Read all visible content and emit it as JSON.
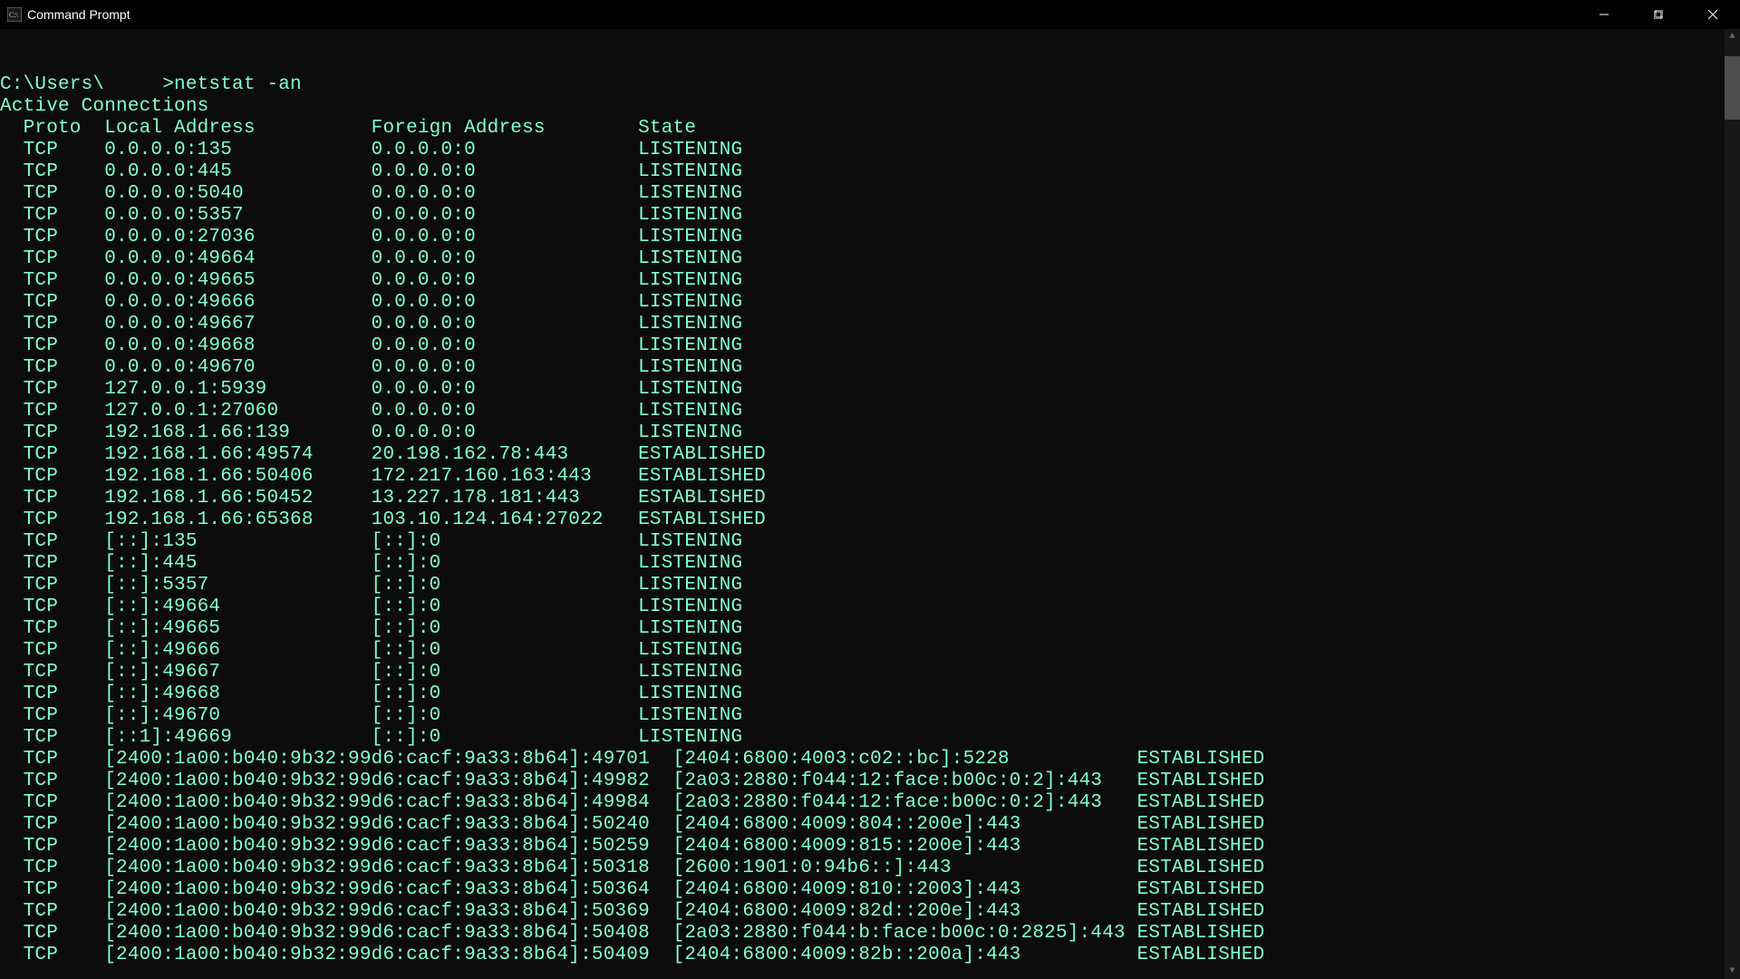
{
  "window": {
    "title": "Command Prompt"
  },
  "prompt": {
    "path": "C:\\Users\\",
    "command": ">netstat -an"
  },
  "section_header": "Active Connections",
  "columns": {
    "proto": "Proto",
    "local": "Local Address",
    "foreign": "Foreign Address",
    "state": "State"
  },
  "rows": [
    {
      "proto": "TCP",
      "local": "0.0.0.0:135",
      "foreign": "0.0.0.0:0",
      "state": "LISTENING"
    },
    {
      "proto": "TCP",
      "local": "0.0.0.0:445",
      "foreign": "0.0.0.0:0",
      "state": "LISTENING"
    },
    {
      "proto": "TCP",
      "local": "0.0.0.0:5040",
      "foreign": "0.0.0.0:0",
      "state": "LISTENING"
    },
    {
      "proto": "TCP",
      "local": "0.0.0.0:5357",
      "foreign": "0.0.0.0:0",
      "state": "LISTENING"
    },
    {
      "proto": "TCP",
      "local": "0.0.0.0:27036",
      "foreign": "0.0.0.0:0",
      "state": "LISTENING"
    },
    {
      "proto": "TCP",
      "local": "0.0.0.0:49664",
      "foreign": "0.0.0.0:0",
      "state": "LISTENING"
    },
    {
      "proto": "TCP",
      "local": "0.0.0.0:49665",
      "foreign": "0.0.0.0:0",
      "state": "LISTENING"
    },
    {
      "proto": "TCP",
      "local": "0.0.0.0:49666",
      "foreign": "0.0.0.0:0",
      "state": "LISTENING"
    },
    {
      "proto": "TCP",
      "local": "0.0.0.0:49667",
      "foreign": "0.0.0.0:0",
      "state": "LISTENING"
    },
    {
      "proto": "TCP",
      "local": "0.0.0.0:49668",
      "foreign": "0.0.0.0:0",
      "state": "LISTENING"
    },
    {
      "proto": "TCP",
      "local": "0.0.0.0:49670",
      "foreign": "0.0.0.0:0",
      "state": "LISTENING"
    },
    {
      "proto": "TCP",
      "local": "127.0.0.1:5939",
      "foreign": "0.0.0.0:0",
      "state": "LISTENING"
    },
    {
      "proto": "TCP",
      "local": "127.0.0.1:27060",
      "foreign": "0.0.0.0:0",
      "state": "LISTENING"
    },
    {
      "proto": "TCP",
      "local": "192.168.1.66:139",
      "foreign": "0.0.0.0:0",
      "state": "LISTENING"
    },
    {
      "proto": "TCP",
      "local": "192.168.1.66:49574",
      "foreign": "20.198.162.78:443",
      "state": "ESTABLISHED"
    },
    {
      "proto": "TCP",
      "local": "192.168.1.66:50406",
      "foreign": "172.217.160.163:443",
      "state": "ESTABLISHED"
    },
    {
      "proto": "TCP",
      "local": "192.168.1.66:50452",
      "foreign": "13.227.178.181:443",
      "state": "ESTABLISHED"
    },
    {
      "proto": "TCP",
      "local": "192.168.1.66:65368",
      "foreign": "103.10.124.164:27022",
      "state": "ESTABLISHED"
    },
    {
      "proto": "TCP",
      "local": "[::]:135",
      "foreign": "[::]:0",
      "state": "LISTENING"
    },
    {
      "proto": "TCP",
      "local": "[::]:445",
      "foreign": "[::]:0",
      "state": "LISTENING"
    },
    {
      "proto": "TCP",
      "local": "[::]:5357",
      "foreign": "[::]:0",
      "state": "LISTENING"
    },
    {
      "proto": "TCP",
      "local": "[::]:49664",
      "foreign": "[::]:0",
      "state": "LISTENING"
    },
    {
      "proto": "TCP",
      "local": "[::]:49665",
      "foreign": "[::]:0",
      "state": "LISTENING"
    },
    {
      "proto": "TCP",
      "local": "[::]:49666",
      "foreign": "[::]:0",
      "state": "LISTENING"
    },
    {
      "proto": "TCP",
      "local": "[::]:49667",
      "foreign": "[::]:0",
      "state": "LISTENING"
    },
    {
      "proto": "TCP",
      "local": "[::]:49668",
      "foreign": "[::]:0",
      "state": "LISTENING"
    },
    {
      "proto": "TCP",
      "local": "[::]:49670",
      "foreign": "[::]:0",
      "state": "LISTENING"
    },
    {
      "proto": "TCP",
      "local": "[::1]:49669",
      "foreign": "[::]:0",
      "state": "LISTENING"
    }
  ],
  "rows_wide": [
    {
      "proto": "TCP",
      "local": "[2400:1a00:b040:9b32:99d6:cacf:9a33:8b64]:49701",
      "foreign": "[2404:6800:4003:c02::bc]:5228",
      "state": "ESTABLISHED"
    },
    {
      "proto": "TCP",
      "local": "[2400:1a00:b040:9b32:99d6:cacf:9a33:8b64]:49982",
      "foreign": "[2a03:2880:f044:12:face:b00c:0:2]:443",
      "state": "ESTABLISHED"
    },
    {
      "proto": "TCP",
      "local": "[2400:1a00:b040:9b32:99d6:cacf:9a33:8b64]:49984",
      "foreign": "[2a03:2880:f044:12:face:b00c:0:2]:443",
      "state": "ESTABLISHED"
    },
    {
      "proto": "TCP",
      "local": "[2400:1a00:b040:9b32:99d6:cacf:9a33:8b64]:50240",
      "foreign": "[2404:6800:4009:804::200e]:443",
      "state": "ESTABLISHED"
    },
    {
      "proto": "TCP",
      "local": "[2400:1a00:b040:9b32:99d6:cacf:9a33:8b64]:50259",
      "foreign": "[2404:6800:4009:815::200e]:443",
      "state": "ESTABLISHED"
    },
    {
      "proto": "TCP",
      "local": "[2400:1a00:b040:9b32:99d6:cacf:9a33:8b64]:50318",
      "foreign": "[2600:1901:0:94b6::]:443",
      "state": "ESTABLISHED"
    },
    {
      "proto": "TCP",
      "local": "[2400:1a00:b040:9b32:99d6:cacf:9a33:8b64]:50364",
      "foreign": "[2404:6800:4009:810::2003]:443",
      "state": "ESTABLISHED"
    },
    {
      "proto": "TCP",
      "local": "[2400:1a00:b040:9b32:99d6:cacf:9a33:8b64]:50369",
      "foreign": "[2404:6800:4009:82d::200e]:443",
      "state": "ESTABLISHED"
    },
    {
      "proto": "TCP",
      "local": "[2400:1a00:b040:9b32:99d6:cacf:9a33:8b64]:50408",
      "foreign": "[2a03:2880:f044:b:face:b00c:0:2825]:443",
      "state": "ESTABLISHED"
    },
    {
      "proto": "TCP",
      "local": "[2400:1a00:b040:9b32:99d6:cacf:9a33:8b64]:50409",
      "foreign": "[2404:6800:4009:82b::200a]:443",
      "state": "ESTABLISHED"
    }
  ]
}
